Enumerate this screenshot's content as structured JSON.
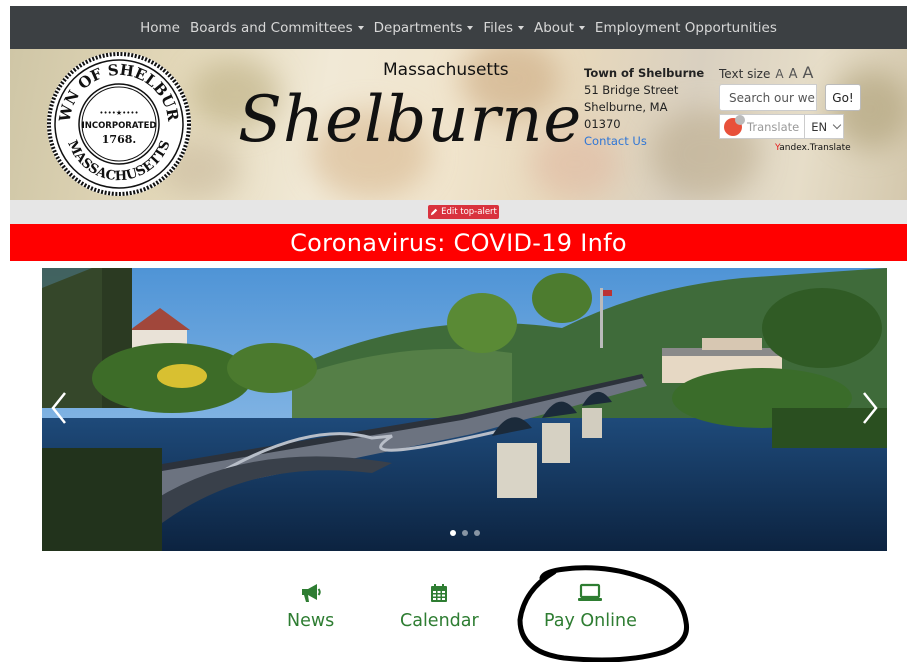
{
  "nav": {
    "items": [
      {
        "label": "Home",
        "dropdown": false
      },
      {
        "label": "Boards and Committees",
        "dropdown": true
      },
      {
        "label": "Departments",
        "dropdown": true
      },
      {
        "label": "Files",
        "dropdown": true
      },
      {
        "label": "About",
        "dropdown": true
      },
      {
        "label": "Employment Opportunities",
        "dropdown": false
      }
    ]
  },
  "header": {
    "seal": {
      "top_text": "TOWN OF SHELBURNE",
      "bottom_text": "MASSACHUSETTS",
      "center_line1": "INCORPORATED",
      "center_line2": "1768."
    },
    "state": "Massachusetts",
    "town_name": "Shelburne",
    "address": {
      "title": "Town of Shelburne",
      "street": "51 Bridge Street",
      "city": "Shelburne, MA",
      "zip": "01370",
      "contact_link": "Contact Us"
    },
    "text_size": {
      "label": "Text size",
      "small": "A",
      "medium": "A",
      "large": "A"
    },
    "search": {
      "placeholder": "Search our websi",
      "button": "Go!"
    },
    "translate": {
      "label": "Translate",
      "language": "EN",
      "credit_y": "Y",
      "credit_rest": "andex.Translate"
    }
  },
  "alert": {
    "edit_button": "Edit top-alert",
    "banner_text": "Coronavirus: COVID-19 Info"
  },
  "carousel": {
    "slide_count": 3,
    "active_slide": 1
  },
  "quick_links": [
    {
      "label": "News",
      "icon": "megaphone-icon"
    },
    {
      "label": "Calendar",
      "icon": "calendar-icon"
    },
    {
      "label": "Pay Online",
      "icon": "laptop-icon"
    }
  ],
  "colors": {
    "nav_bg": "#3c4043",
    "alert_red": "#ff0000",
    "accent_green": "#2e7d32",
    "edit_red": "#d9323e",
    "link_blue": "#2f76d6"
  }
}
